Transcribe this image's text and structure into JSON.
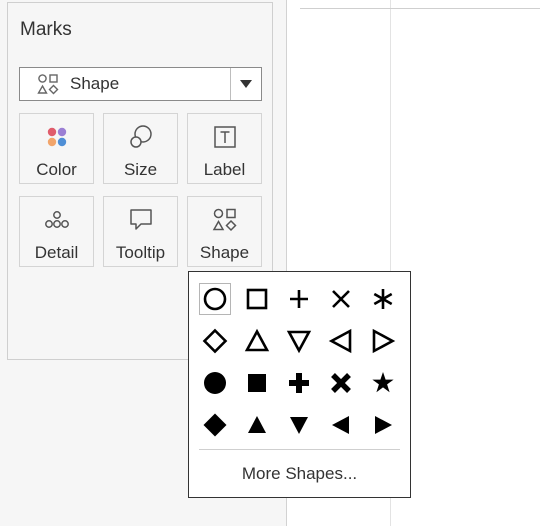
{
  "marks": {
    "title": "Marks",
    "mark_type": {
      "selected_label": "Shape",
      "icon": "shapes-icon"
    },
    "tiles": [
      {
        "label": "Color",
        "icon": "color-icon"
      },
      {
        "label": "Size",
        "icon": "size-icon"
      },
      {
        "label": "Label",
        "icon": "label-icon"
      },
      {
        "label": "Detail",
        "icon": "detail-icon"
      },
      {
        "label": "Tooltip",
        "icon": "tooltip-icon"
      },
      {
        "label": "Shape",
        "icon": "shape-icon"
      }
    ]
  },
  "shape_popup": {
    "shapes": [
      "circle-outline",
      "square-outline",
      "plus",
      "cross",
      "asterisk",
      "diamond-outline",
      "triangle-up-outline",
      "triangle-down-outline",
      "triangle-left-outline",
      "triangle-right-outline",
      "circle-filled",
      "square-filled",
      "plus-filled",
      "cross-filled",
      "star-filled",
      "diamond-filled",
      "triangle-up-filled",
      "triangle-down-filled",
      "triangle-left-filled",
      "triangle-right-filled"
    ],
    "selected_shape": "circle-outline",
    "more_label": "More Shapes..."
  },
  "colors": {
    "palette_dots": [
      "#e05c6b",
      "#9b7fd4",
      "#f2a56b",
      "#4f8fd6"
    ]
  }
}
